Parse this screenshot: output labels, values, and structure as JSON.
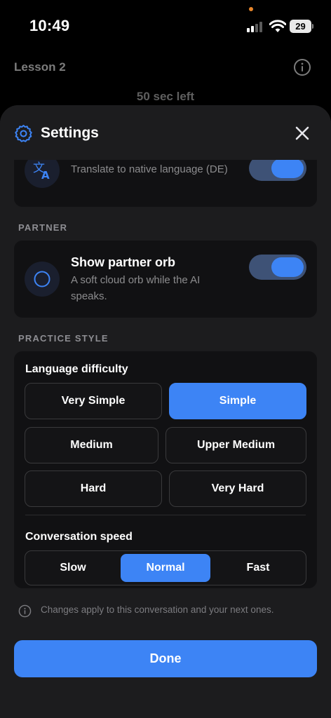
{
  "status_bar": {
    "time": "10:49",
    "battery": "29"
  },
  "header": {
    "lesson": "Lesson 2",
    "time_left": "50 sec left"
  },
  "sheet": {
    "title": "Settings",
    "translate_row": {
      "subtitle": "Translate to native language (DE)",
      "icon": "translate-icon",
      "toggle_on": true
    },
    "partner_section": {
      "label": "PARTNER"
    },
    "partner_row": {
      "title": "Show partner orb",
      "subtitle": "A soft cloud orb while the AI speaks.",
      "icon": "orb-icon",
      "toggle_on": true
    },
    "practice_section": {
      "label": "PRACTICE STYLE"
    },
    "difficulty": {
      "label": "Language difficulty",
      "options": [
        "Very Simple",
        "Simple",
        "Medium",
        "Upper Medium",
        "Hard",
        "Very Hard"
      ],
      "selected": "Simple"
    },
    "speed": {
      "label": "Conversation speed",
      "options": [
        "Slow",
        "Normal",
        "Fast"
      ],
      "selected": "Normal"
    },
    "note": "Changes apply to this conversation and your next ones.",
    "done_label": "Done"
  },
  "colors": {
    "accent": "#3d84f5",
    "sheet_bg": "#1c1c1e",
    "card_bg": "#111113",
    "toggle_track": "#3e5276"
  }
}
